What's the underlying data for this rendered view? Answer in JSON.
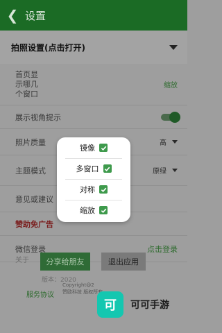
{
  "header": {
    "back_icon": "chevron-left-icon",
    "title": "设置"
  },
  "section": {
    "label": "拍照设置(点击打开)"
  },
  "rows": {
    "home_show_line1": "首页显",
    "home_show_line2": "示哪几",
    "home_show_line3": "个窗口",
    "home_show_value": "缩放",
    "view_angle_label": "展示视角提示",
    "view_angle_on": true,
    "photo_quality_label": "照片质量",
    "photo_quality_value": "高",
    "theme_label": "主题模式",
    "theme_value": "原绿",
    "feedback_label": "意见或建议",
    "sponsor_label": "赞助免广告",
    "wechat_label": "微信登录",
    "wechat_action": "点击登录"
  },
  "footer": {
    "about": "关于",
    "share": "分享给朋友",
    "exit": "退出应用",
    "version": "版本：2020",
    "service": "服务协议",
    "copyright_line1": "Copyright@2",
    "copyright_line2": "赞欧科技 版权所有"
  },
  "dialog": {
    "options": [
      {
        "label": "镜像",
        "checked": true
      },
      {
        "label": "多窗口",
        "checked": true
      },
      {
        "label": "对称",
        "checked": true
      },
      {
        "label": "缩放",
        "checked": true
      }
    ]
  },
  "watermark": {
    "logo_text": "可",
    "brand": "可可手游"
  },
  "colors": {
    "appbar": "#1b6b25",
    "accent": "#3e9a4c",
    "overlay": "#9e9e9e"
  }
}
